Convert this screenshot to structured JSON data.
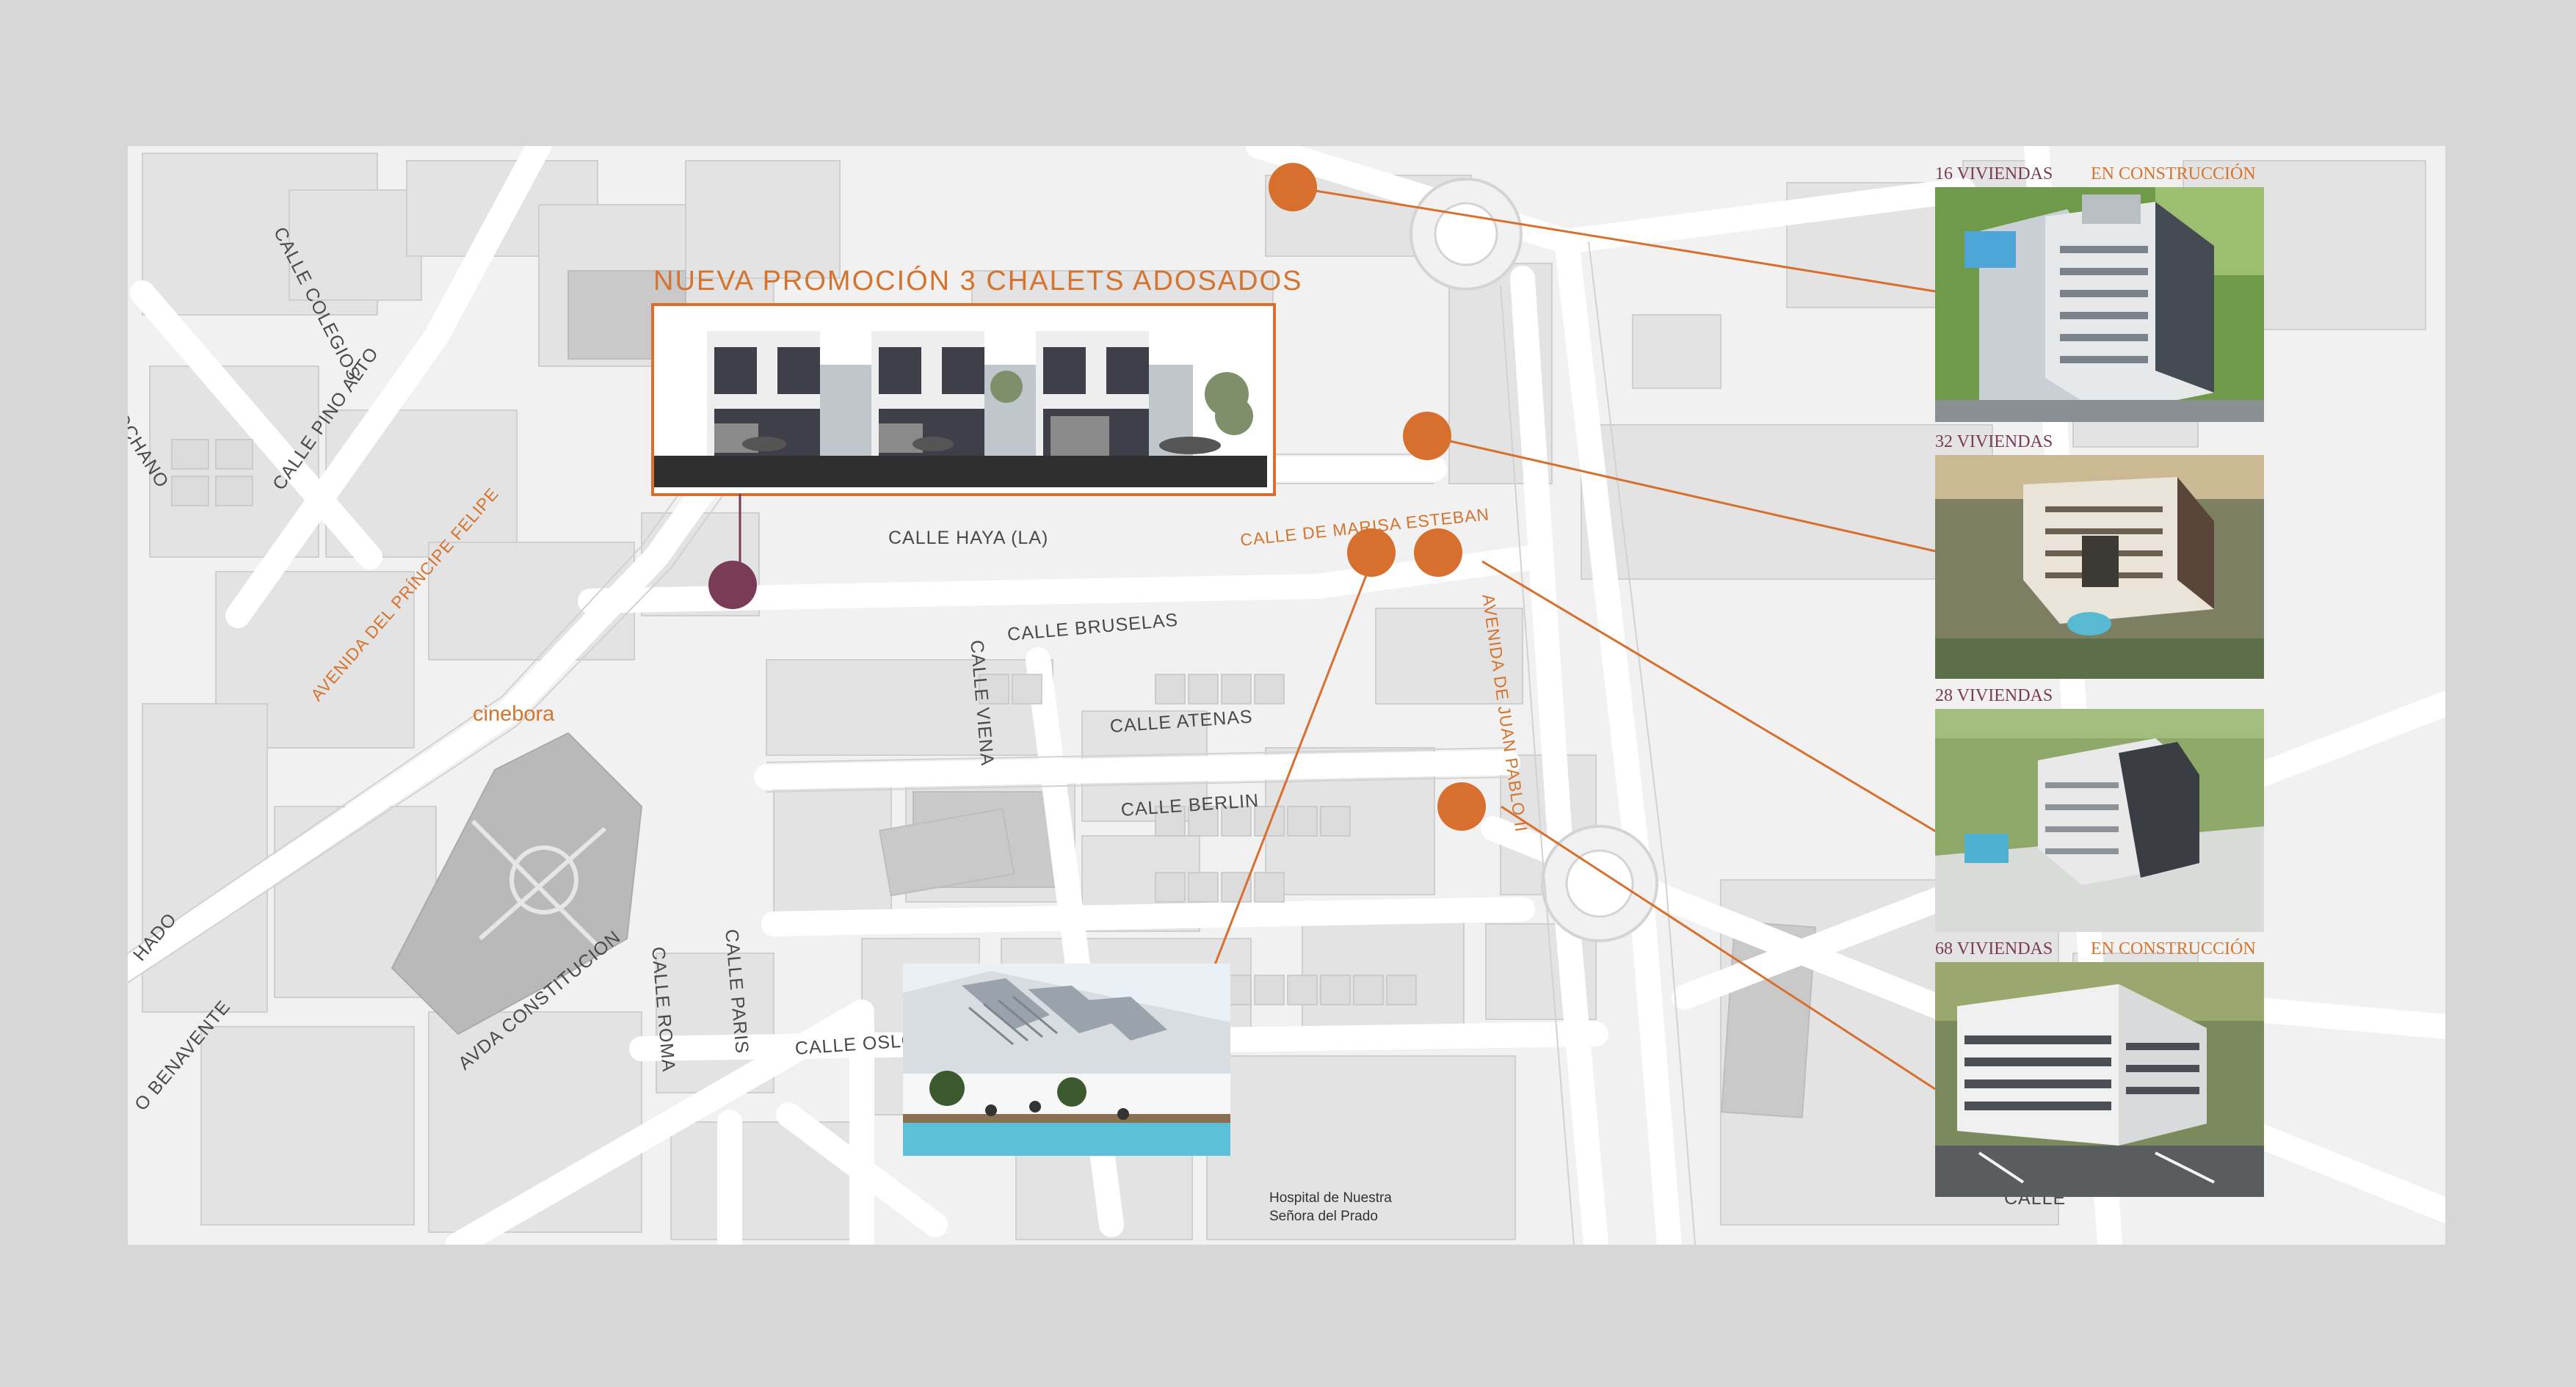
{
  "promo": {
    "title": "NUEVA PROMOCIÓN 3 CHALETS ADOSADOS"
  },
  "streets": {
    "colegios": "CALLE COLEGIOS",
    "pino_alto": "CALLE PINO ALTO",
    "ochano": "OCHANO",
    "principe": "AVENIDA DEL PRÍNCIPE FELIPE",
    "haya": "CALLE HAYA (LA)",
    "marisa": "CALLE DE MARISA ESTEBAN",
    "bruselas": "CALLE BRUSELAS",
    "viena": "CALLE VIENA",
    "atenas": "CALLE ATENAS",
    "berlin": "CALLE BERLIN",
    "juan_pablo": "AVENIDA DE JUAN PABLO II",
    "hado": "HADO",
    "benavente": "O BENAVENTE",
    "constitucion": "AVDA CONSTITUCION",
    "roma": "CALLE ROMA",
    "paris": "CALLE PARIS",
    "oslo": "CALLE OSLO",
    "calle_cut": "CALLE"
  },
  "places": {
    "cinebora": "cinebora",
    "hospital_line1": "Hospital de Nuestra",
    "hospital_line2": "Señora del Prado"
  },
  "cards": [
    {
      "label": "16 VIVIENDAS",
      "status": "EN CONSTRUCCIÓN"
    },
    {
      "label": "32 VIVIENDAS",
      "status": ""
    },
    {
      "label": "28 VIVIENDAS",
      "status": ""
    },
    {
      "label": "68 VIVIENDAS",
      "status": "EN CONSTRUCCIÓN"
    }
  ],
  "colors": {
    "accent_orange": "#d7702f",
    "accent_purple": "#7a3b56",
    "background": "#d7d7d7",
    "map": "#f1f1f1"
  }
}
